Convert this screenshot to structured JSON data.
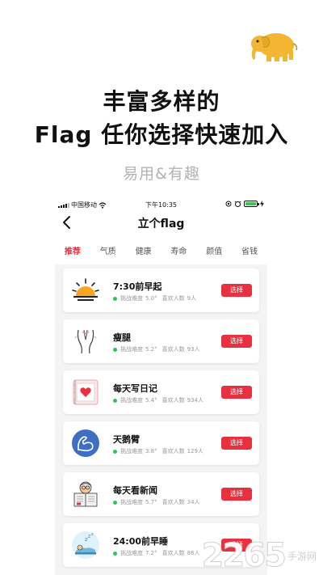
{
  "header": {
    "line1": "丰富多样的",
    "line2": "Flag 任你选择快速加入",
    "subtitle": "易用&有趣"
  },
  "status_bar": {
    "carrier": "中国移动",
    "time": "下午10:35"
  },
  "nav": {
    "title": "立个flag"
  },
  "tabs": [
    "推荐",
    "气质",
    "健康",
    "寿命",
    "颜值",
    "省钱"
  ],
  "active_tab": "推荐",
  "meta_labels": {
    "difficulty": "挑战难度",
    "likes": "喜欢人数"
  },
  "items": [
    {
      "name": "7:30前早起",
      "difficulty": "5.0°",
      "likes": "9人",
      "icon": "sunrise-icon",
      "button": "选择"
    },
    {
      "name": "瘦腿",
      "difficulty": "5.2°",
      "likes": "93人",
      "icon": "legs-icon",
      "button": "选择"
    },
    {
      "name": "每天写日记",
      "difficulty": "5.4°",
      "likes": "934人",
      "icon": "diary-icon",
      "button": "选择"
    },
    {
      "name": "天鹅臂",
      "difficulty": "3.8°",
      "likes": "129人",
      "icon": "arm-icon",
      "button": "选择"
    },
    {
      "name": "每天看新闻",
      "difficulty": "5.7°",
      "likes": "34人",
      "icon": "newspaper-icon",
      "button": "选择"
    },
    {
      "name": "24:00前早睡",
      "difficulty": "7.2°",
      "likes": "86人",
      "icon": "sleep-icon",
      "button": "选择"
    }
  ],
  "watermark": {
    "number": "2265",
    "site": "手游网"
  },
  "colors": {
    "accent": "#e8303f",
    "success": "#2ec35d",
    "logo": "#f2b632"
  }
}
